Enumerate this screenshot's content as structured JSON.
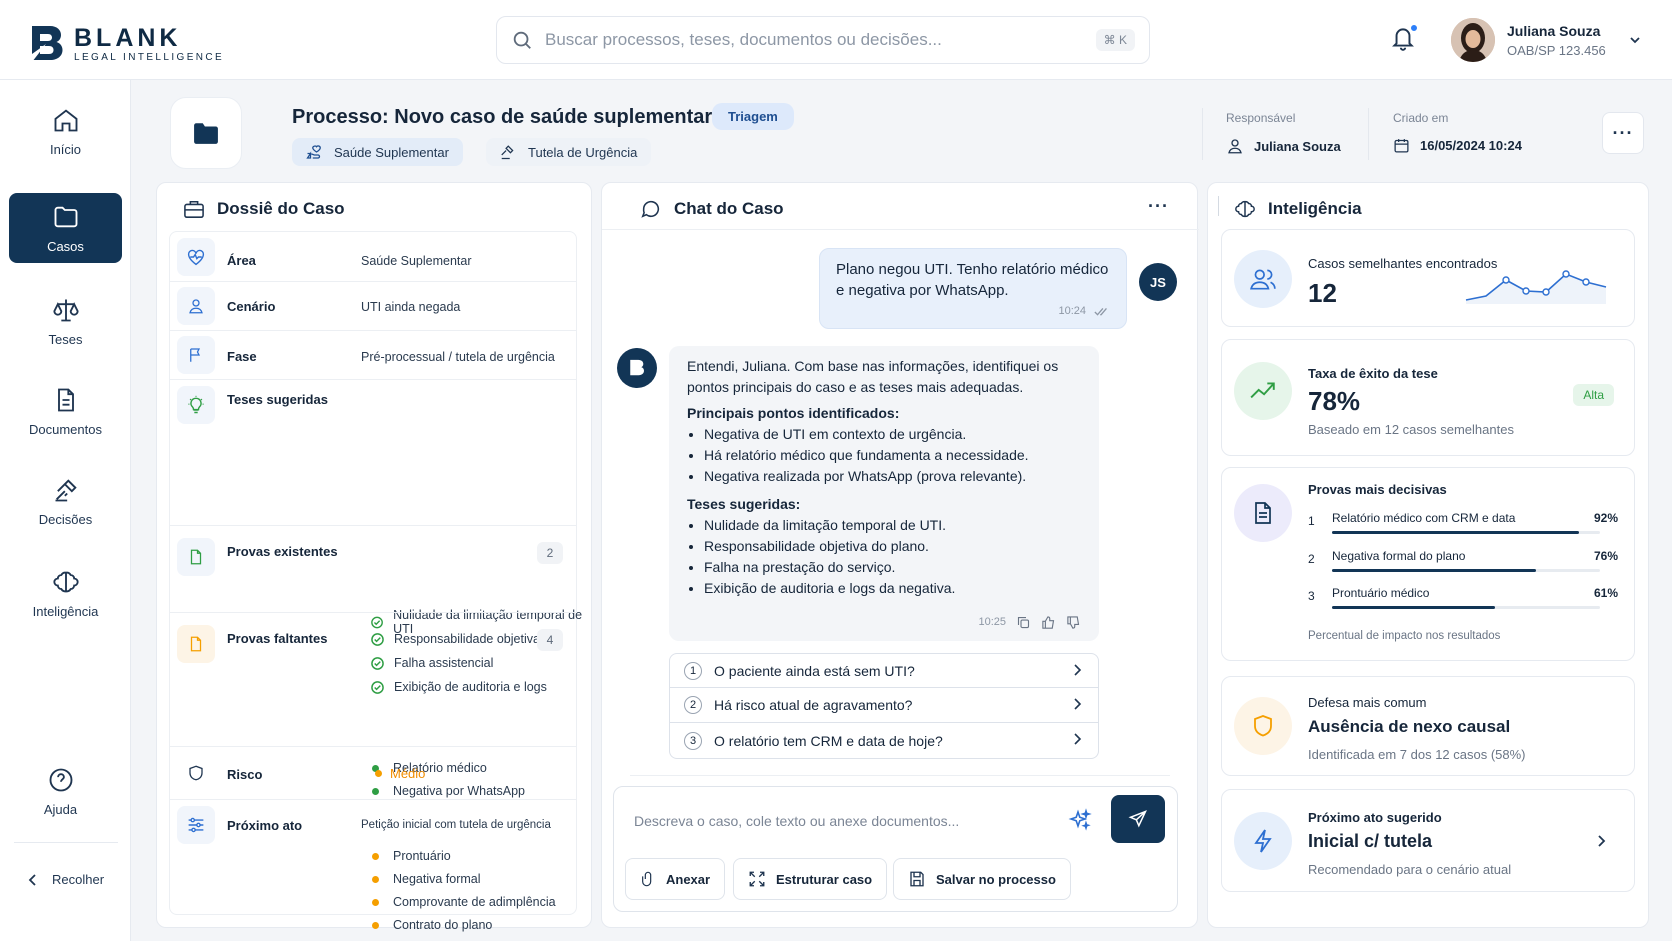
{
  "brand": {
    "name": "BLANK",
    "tagline": "LEGAL INTELLIGENCE"
  },
  "search": {
    "placeholder": "Buscar processos, teses, documentos ou decisões...",
    "shortcut": "⌘ K"
  },
  "user": {
    "name": "Juliana Souza",
    "oab": "OAB/SP 123.456"
  },
  "nav": {
    "items": [
      {
        "label": "Início"
      },
      {
        "label": "Casos"
      },
      {
        "label": "Teses"
      },
      {
        "label": "Documentos"
      },
      {
        "label": "Decisões"
      },
      {
        "label": "Inteligência"
      }
    ],
    "help": "Ajuda",
    "collapse": "Recolher"
  },
  "process": {
    "title": "Processo: Novo caso de saúde suplementar",
    "status": "Triagem",
    "tags": [
      "Saúde Suplementar",
      "Tutela de Urgência"
    ],
    "responsible_label": "Responsável",
    "responsible": "Juliana Souza",
    "created_label": "Criado em",
    "created": "16/05/2024 10:24",
    "more": "···"
  },
  "dossie": {
    "title": "Dossiê do Caso",
    "area": {
      "label": "Área",
      "value": "Saúde Suplementar"
    },
    "cenario": {
      "label": "Cenário",
      "value": "UTI ainda negada"
    },
    "fase": {
      "label": "Fase",
      "value": "Pré-processual / tutela de urgência"
    },
    "teses": {
      "label": "Teses sugeridas",
      "items": [
        "Nulidade da limitação temporal de UTI",
        "Responsabilidade objetiva",
        "Falha assistencial",
        "Exibição de auditoria e logs"
      ]
    },
    "provas_existentes": {
      "label": "Provas existentes",
      "count": "2",
      "items": [
        "Relatório médico",
        "Negativa por WhatsApp"
      ]
    },
    "provas_faltantes": {
      "label": "Provas faltantes",
      "count": "4",
      "items": [
        "Prontuário",
        "Negativa formal",
        "Comprovante de adimplência",
        "Contrato do plano"
      ]
    },
    "risco": {
      "label": "Risco",
      "value": "Médio"
    },
    "proximo": {
      "label": "Próximo ato",
      "value": "Petição inicial com tutela de urgência"
    }
  },
  "chat": {
    "title": "Chat do Caso",
    "user_msg": {
      "text": "Plano negou UTI. Tenho relatório médico e negativa por WhatsApp.",
      "time": "10:24",
      "initials": "JS"
    },
    "bot_msg": {
      "intro": "Entendi, Juliana. Com base nas informações, identifiquei os pontos principais do caso e as teses mais adequadas.",
      "points_title": "Principais pontos identificados:",
      "points": [
        "Negativa de UTI em contexto de urgência.",
        "Há relatório médico que fundamenta a necessidade.",
        "Negativa realizada por WhatsApp (prova relevante)."
      ],
      "theses_title": "Teses sugeridas:",
      "theses": [
        "Nulidade da limitação temporal de UTI.",
        "Responsabilidade objetiva do plano.",
        "Falha na prestação do serviço.",
        "Exibição de auditoria e logs da negativa."
      ],
      "time": "10:25"
    },
    "suggestions": [
      {
        "n": "1",
        "text": "O paciente ainda está sem UTI?"
      },
      {
        "n": "2",
        "text": "Há risco atual de agravamento?"
      },
      {
        "n": "3",
        "text": "O relatório tem CRM e data de hoje?"
      }
    ],
    "input_placeholder": "Descreva o caso, cole texto ou anexe documentos...",
    "actions": {
      "attach": "Anexar",
      "structure": "Estruturar caso",
      "save": "Salvar no processo"
    }
  },
  "intel": {
    "title": "Inteligência",
    "similar": {
      "label": "Casos semelhantes encontrados",
      "value": "12"
    },
    "success": {
      "label": "Taxa de êxito da tese",
      "value": "78%",
      "badge": "Alta",
      "sub": "Baseado em 12 casos semelhantes"
    },
    "evidence": {
      "label": "Provas mais decisivas",
      "items": [
        {
          "n": "1",
          "text": "Relatório médico com CRM e data",
          "pct": "92%",
          "value": 92
        },
        {
          "n": "2",
          "text": "Negativa formal do plano",
          "pct": "76%",
          "value": 76
        },
        {
          "n": "3",
          "text": "Prontuário médico",
          "pct": "61%",
          "value": 61
        }
      ],
      "note": "Percentual de impacto nos resultados"
    },
    "defense": {
      "label": "Defesa mais comum",
      "value": "Ausência de nexo causal",
      "sub": "Identificada em 7 dos 12 casos (58%)"
    },
    "next": {
      "label": "Próximo ato sugerido",
      "value": "Inicial c/ tutela",
      "sub": "Recomendado para o cenário atual"
    }
  },
  "colors": {
    "primary": "#123556",
    "green": "#2f9e44",
    "orange": "#f59f00",
    "accent": "#2d7ff9"
  }
}
